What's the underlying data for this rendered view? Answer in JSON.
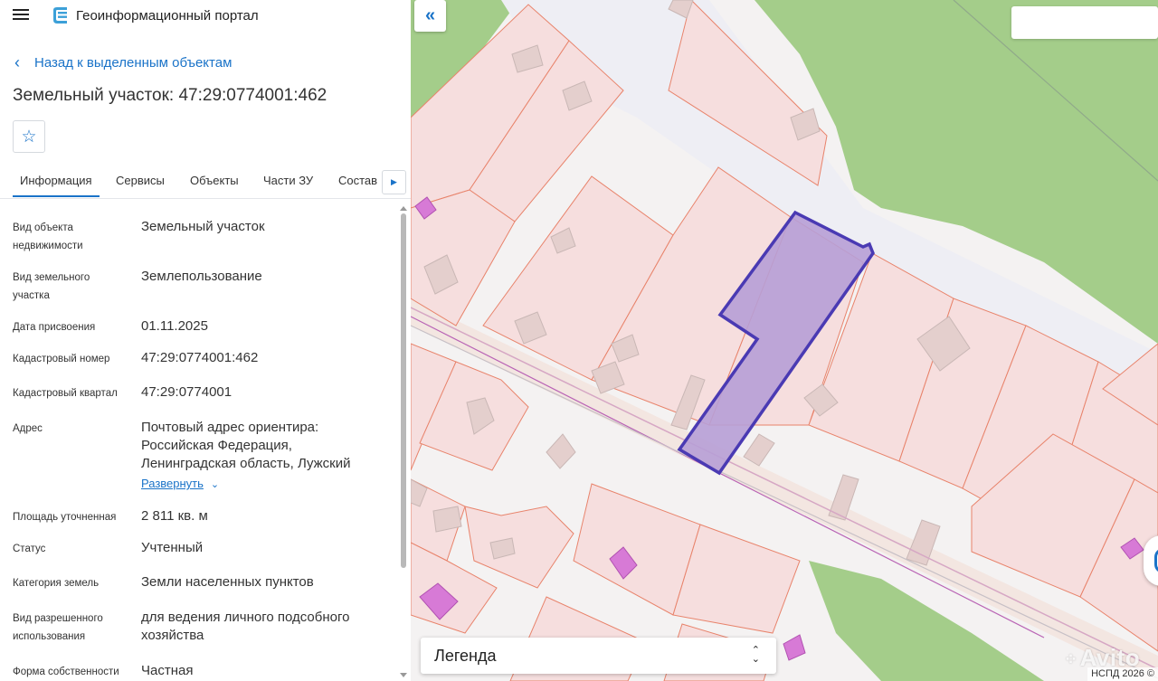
{
  "header": {
    "title": "Геоинформационный портал",
    "logo_icon": "layers-logo-icon",
    "menu_icon": "hamburger-menu-icon"
  },
  "back_link": {
    "label": "Назад к выделенным объектам"
  },
  "object": {
    "title": "Земельный участок: 47:29:0774001:462"
  },
  "tabs": [
    {
      "label": "Информация",
      "active": true
    },
    {
      "label": "Сервисы",
      "active": false
    },
    {
      "label": "Объекты",
      "active": false
    },
    {
      "label": "Части ЗУ",
      "active": false
    },
    {
      "label": "Состав",
      "active": false
    }
  ],
  "properties": [
    {
      "label": "Вид объекта недвижимости",
      "value": "Земельный участок"
    },
    {
      "label": "Вид земельного участка",
      "value": "Землепользование"
    },
    {
      "label": "Дата присвоения",
      "value": "01.11.2025"
    },
    {
      "label": "Кадастровый номер",
      "value": "47:29:0774001:462"
    },
    {
      "label": "Кадастровый квартал",
      "value": "47:29:0774001"
    },
    {
      "label": "Адрес",
      "value": "Почтовый адрес ориентира: Российская Федерация, Ленинградская область, Лужский"
    },
    {
      "label": "Площадь уточненная",
      "value": "2 811 кв. м"
    },
    {
      "label": "Статус",
      "value": "Учтенный"
    },
    {
      "label": "Категория земель",
      "value": "Земли населенных пунктов"
    },
    {
      "label": "Вид разрешенного использования",
      "value": "для ведения личного подсобного хозяйства"
    },
    {
      "label": "Форма собственности",
      "value": "Частная"
    }
  ],
  "address_expand": {
    "label": "Развернуть"
  },
  "map": {
    "legend_label": "Легенда",
    "credit": "НСПД 2026 ©",
    "watermark": "Avito",
    "search_placeholder": "",
    "colors": {
      "parcel_fill": "#f6dede",
      "parcel_stroke": "#e8836b",
      "selected_fill": "#b79fd6",
      "selected_stroke": "#4a3ab3",
      "green": "#a4cd8a",
      "road": "#eeeef4",
      "building": "#e4cfcd",
      "magenta": "#d77ad6"
    }
  }
}
